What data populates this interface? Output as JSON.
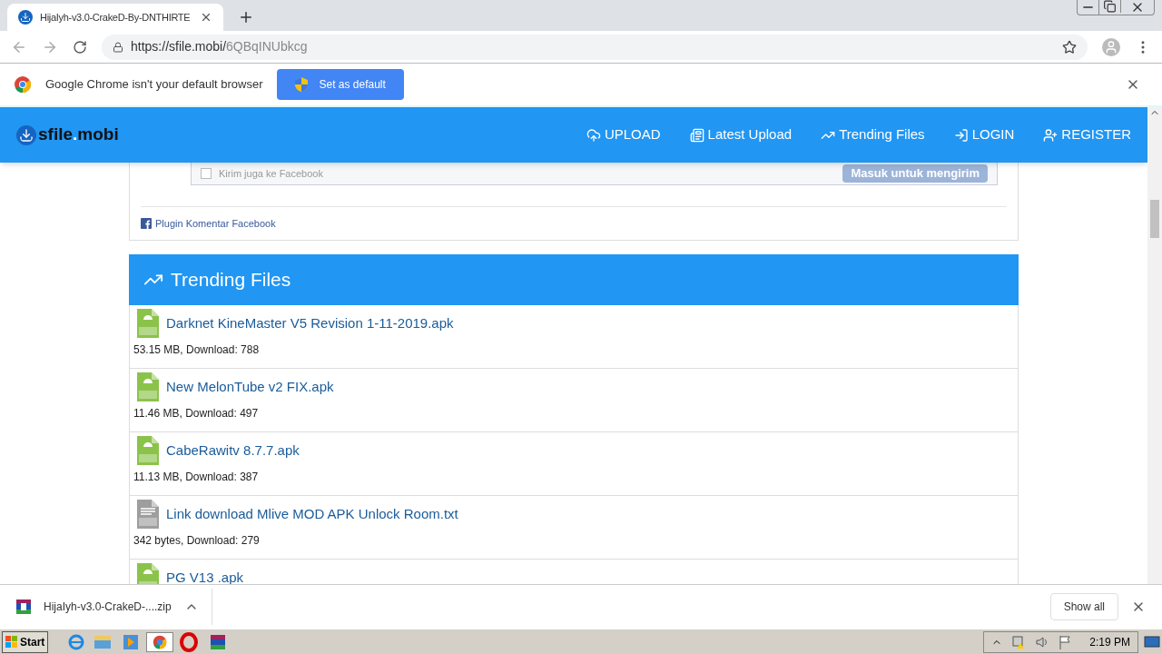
{
  "browser": {
    "tab_title": "HijaIyh-v3.0-CrakeD-By-DNTHIRTE",
    "url_host": "https://sfile.mobi/",
    "url_path": "6QBqINUbkcg"
  },
  "infobar": {
    "message": "Google Chrome isn't your default browser",
    "button": "Set as default"
  },
  "site": {
    "logo": "sfile",
    "logo_dot": ".",
    "logo_tail": "mobi",
    "nav": [
      {
        "label": "UPLOAD",
        "kind": "upload"
      },
      {
        "label": "Latest Upload",
        "kind": "latest"
      },
      {
        "label": "Trending Files",
        "kind": "trending"
      },
      {
        "label": "LOGIN",
        "kind": "login"
      },
      {
        "label": "REGISTER",
        "kind": "register"
      }
    ]
  },
  "comments": {
    "checkbox_label": "Kirim juga ke Facebook",
    "checked": false,
    "submit": "Masuk untuk mengirim",
    "plugin_link": "Plugin Komentar Facebook"
  },
  "trending": {
    "title": "Trending Files",
    "files": [
      {
        "name": "Darknet KineMaster V5 Revision 1-11-2019.apk",
        "kind": "apk",
        "meta": "53.15 MB, Download: 788"
      },
      {
        "name": "New MelonTube v2 FIX.apk",
        "kind": "apk",
        "meta": "11.46 MB, Download: 497"
      },
      {
        "name": "CabeRawitv 8.7.7.apk",
        "kind": "apk",
        "meta": "11.13 MB, Download: 387"
      },
      {
        "name": "Link download Mlive MOD APK Unlock Room.txt",
        "kind": "txt",
        "meta": "342 bytes, Download: 279"
      },
      {
        "name": "PG V13 .apk",
        "kind": "apk"
      }
    ]
  },
  "download_bar": {
    "file": "HijaIyh-v3.0-CrakeD-....zip",
    "show_all": "Show all"
  },
  "taskbar": {
    "start": "Start",
    "clock": "2:19 PM"
  }
}
